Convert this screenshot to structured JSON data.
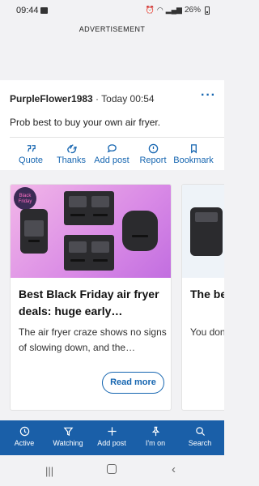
{
  "status": {
    "time": "09:44",
    "battery": "26%"
  },
  "ad": {
    "label": "ADVERTISEMENT"
  },
  "post": {
    "username": "PurpleFlower1983",
    "separator": " · ",
    "time": "Today 00:54",
    "more": "···",
    "body": "Prob best to buy your own air fryer.",
    "actions": [
      {
        "label": "Quote",
        "icon": "quote-icon"
      },
      {
        "label": "Thanks",
        "icon": "clap-icon"
      },
      {
        "label": "Add post",
        "icon": "speech-bubble-icon"
      },
      {
        "label": "Report",
        "icon": "alert-circle-icon"
      },
      {
        "label": "Bookmark",
        "icon": "bookmark-icon"
      }
    ]
  },
  "cards": [
    {
      "badge_line1": "Black",
      "badge_line2": "Friday",
      "title": "Best Black Friday air fryer deals: huge early…",
      "desc": "The air fryer craze shows no signs of slowing down, and the…",
      "button": "Read more"
    },
    {
      "title": "The be fryers,",
      "desc": "You don to cook"
    }
  ],
  "bottom_nav": [
    {
      "label": "Active",
      "icon": "clock-icon"
    },
    {
      "label": "Watching",
      "icon": "filter-icon"
    },
    {
      "label": "Add post",
      "icon": "plus-icon"
    },
    {
      "label": "I'm on",
      "icon": "pin-icon"
    },
    {
      "label": "Search",
      "icon": "search-icon"
    }
  ],
  "colors": {
    "brand": "#1a5fa8",
    "accent": "#1565b0"
  }
}
